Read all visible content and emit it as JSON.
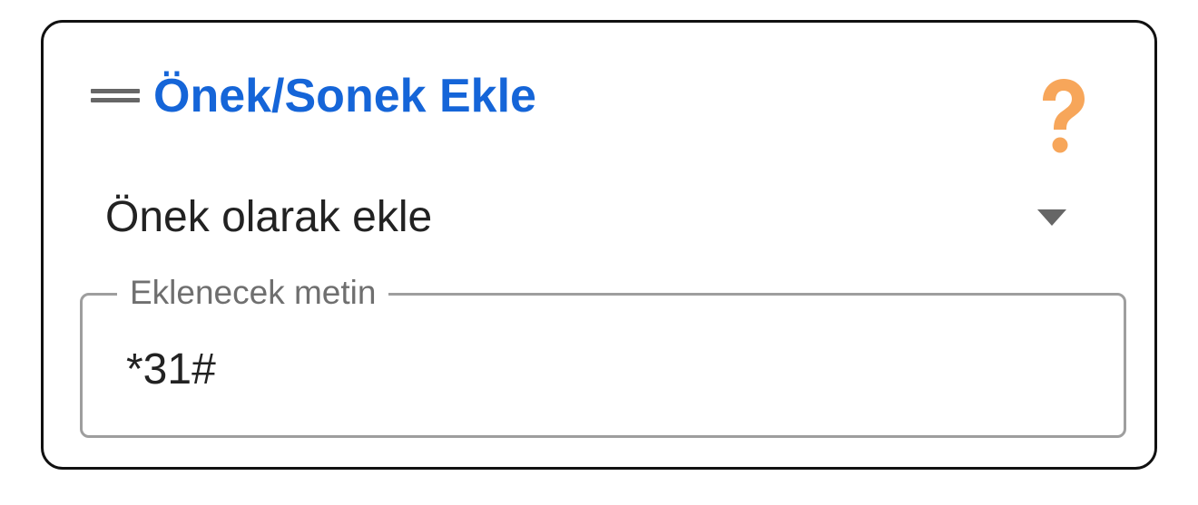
{
  "card": {
    "title": "Önek/Sonek Ekle",
    "title_color": "#1565d8",
    "drag_icon": "drag-handle-icon",
    "help_icon": "question-mark-icon",
    "help_icon_color": "#f7a65a"
  },
  "mode_select": {
    "selected_value": "Önek olarak ekle",
    "arrow_icon": "dropdown-arrow-icon"
  },
  "text_field": {
    "label": "Eklenecek metin",
    "value": "*31#"
  }
}
